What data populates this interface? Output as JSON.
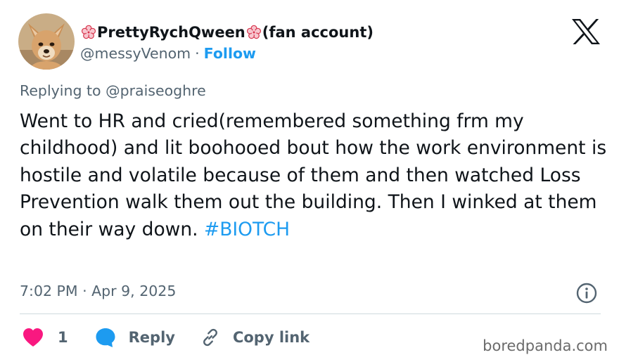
{
  "author": {
    "display_name": "PrettyRychQween",
    "name_suffix": "(fan account)",
    "handle": "@messyVenom",
    "separator": "·",
    "follow_label": "Follow",
    "avatar_icon": "chihuahua-avatar"
  },
  "reply_to": "Replying to @praiseoghre",
  "tweet": {
    "text": "Went to HR and cried(remembered something frm my childhood) and lit boohooed bout how the work environment is hostile and volatile because of them and then watched Loss Prevention walk them out the building. Then I winked at them on their way down. ",
    "hashtag": "#BIOTCH"
  },
  "timestamp": "7:02 PM · Apr 9, 2025",
  "actions": {
    "like_count": "1",
    "reply_label": "Reply",
    "copy_label": "Copy link"
  },
  "watermark": "boredpanda.com",
  "colors": {
    "accent": "#1d9bf0",
    "like": "#f91880",
    "secondary_text": "#536471",
    "primary_text": "#0f1419"
  },
  "icons": [
    "x-logo-icon",
    "info-icon",
    "heart-icon",
    "speech-bubble-icon",
    "link-icon",
    "cherry-blossom-icon"
  ]
}
